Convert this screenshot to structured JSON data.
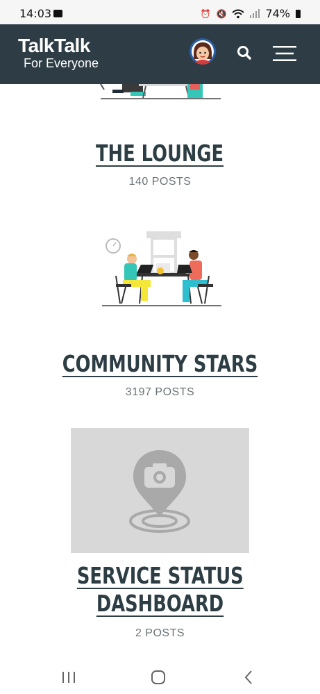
{
  "status_bar": {
    "time": "14:03",
    "battery": "74%"
  },
  "header": {
    "logo_main": "TalkTalk",
    "logo_sub": "For Everyone",
    "brand_color": "#2e3d45"
  },
  "categories": [
    {
      "title": "THE LOUNGE",
      "posts": "140 POSTS"
    },
    {
      "title": "COMMUNITY STARS",
      "posts": "3197 POSTS"
    },
    {
      "title": "SERVICE STATUS",
      "title_line2": "DASHBOARD",
      "posts": "2 POSTS"
    }
  ],
  "icons": {
    "gallery": "image-icon",
    "alarm": "alarm-icon",
    "mute": "mute-icon",
    "wifi": "wifi-icon",
    "signal": "signal-icon",
    "battery": "battery-icon",
    "avatar": "avatar",
    "search": "search-icon",
    "menu": "hamburger-menu-icon",
    "placeholder": "camera-location-pin-icon",
    "nav_recents": "recents-icon",
    "nav_home": "home-icon",
    "nav_back": "back-icon"
  }
}
